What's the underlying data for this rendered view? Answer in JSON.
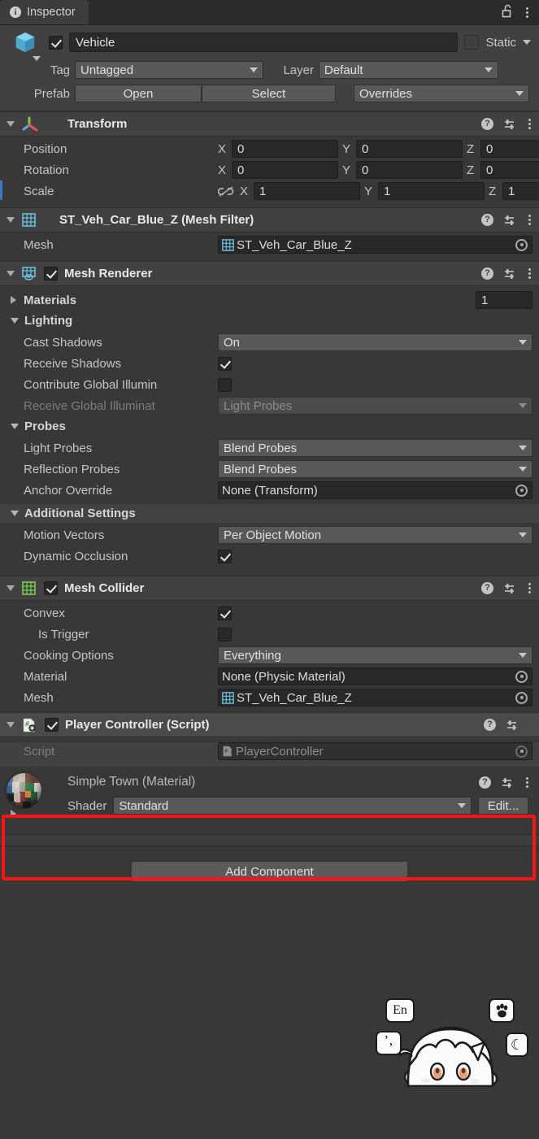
{
  "window": {
    "tab_label": "Inspector",
    "tab_icon": "info-icon",
    "lock_icon": "padlock-unlocked-icon",
    "menu_icon": "kebab-menu-icon"
  },
  "gameobject": {
    "icon": "cube-icon",
    "enabled": true,
    "name": "Vehicle",
    "static_label": "Static",
    "static_checked": false,
    "tag_label": "Tag",
    "tag_value": "Untagged",
    "layer_label": "Layer",
    "layer_value": "Default",
    "prefab_label": "Prefab",
    "prefab_open": "Open",
    "prefab_select": "Select",
    "prefab_overrides": "Overrides"
  },
  "components": [
    {
      "id": "transform",
      "title": "Transform",
      "icon": "transform-axis-icon",
      "rows": [
        {
          "label": "Position",
          "axes": [
            {
              "axis": "X",
              "value": "0"
            },
            {
              "axis": "Y",
              "value": "0"
            },
            {
              "axis": "Z",
              "value": "0"
            }
          ]
        },
        {
          "label": "Rotation",
          "axes": [
            {
              "axis": "X",
              "value": "0"
            },
            {
              "axis": "Y",
              "value": "0"
            },
            {
              "axis": "Z",
              "value": "0"
            }
          ]
        },
        {
          "label": "Scale",
          "link_icon": "broken-link-icon",
          "axes": [
            {
              "axis": "X",
              "value": "1"
            },
            {
              "axis": "Y",
              "value": "1"
            },
            {
              "axis": "Z",
              "value": "1"
            }
          ]
        }
      ]
    },
    {
      "id": "mesh-filter",
      "title": "ST_Veh_Car_Blue_Z (Mesh Filter)",
      "icon": "mesh-filter-grid-icon",
      "mesh_label": "Mesh",
      "mesh_value": "ST_Veh_Car_Blue_Z"
    },
    {
      "id": "mesh-renderer",
      "title": "Mesh Renderer",
      "icon": "mesh-renderer-icon",
      "enabled": true,
      "materials_label": "Materials",
      "materials_count": "1",
      "lighting_label": "Lighting",
      "cast_shadows_label": "Cast Shadows",
      "cast_shadows_value": "On",
      "receive_shadows_label": "Receive Shadows",
      "receive_shadows_checked": true,
      "contribute_gi_label": "Contribute Global Illumin",
      "contribute_gi_checked": false,
      "receive_gi_label": "Receive Global Illuminat",
      "receive_gi_value": "Light Probes",
      "probes_label": "Probes",
      "light_probes_label": "Light Probes",
      "light_probes_value": "Blend Probes",
      "reflection_probes_label": "Reflection Probes",
      "reflection_probes_value": "Blend Probes",
      "anchor_override_label": "Anchor Override",
      "anchor_override_value": "None (Transform)",
      "additional_settings_label": "Additional Settings",
      "motion_vectors_label": "Motion Vectors",
      "motion_vectors_value": "Per Object Motion",
      "dynamic_occlusion_label": "Dynamic Occlusion",
      "dynamic_occlusion_checked": true
    },
    {
      "id": "mesh-collider",
      "title": "Mesh Collider",
      "icon": "mesh-collider-grid-icon",
      "enabled": true,
      "convex_label": "Convex",
      "convex_checked": true,
      "is_trigger_label": "Is Trigger",
      "is_trigger_checked": false,
      "cooking_options_label": "Cooking Options",
      "cooking_options_value": "Everything",
      "material_label": "Material",
      "material_value": "None (Physic Material)",
      "mesh_label": "Mesh",
      "mesh_value": "ST_Veh_Car_Blue_Z"
    },
    {
      "id": "player-controller",
      "title": "Player Controller (Script)",
      "icon": "csharp-script-icon",
      "enabled": true,
      "script_label": "Script",
      "script_value": "PlayerController",
      "highlighted": true
    },
    {
      "id": "simple-town-material",
      "title": "Simple Town (Material)",
      "icon": "material-sphere-preview",
      "shader_label": "Shader",
      "shader_value": "Standard",
      "edit_label": "Edit..."
    }
  ],
  "footer": {
    "add_component_label": "Add Component"
  },
  "ime_widget": {
    "name": "sogou-ime-floating-widget",
    "keys": [
      {
        "name": "ime-mode-english",
        "label": "En"
      },
      {
        "name": "ime-paw-toolbox",
        "label": "✻"
      },
      {
        "name": "ime-punctuation",
        "label": "’‚"
      },
      {
        "name": "ime-night-mode",
        "label": "☾"
      }
    ]
  },
  "colors": {
    "window_bg": "#383838",
    "header_bg": "#414141",
    "field_bg": "#282828",
    "dropdown_bg": "#585858",
    "accent_blue": "#3a79bb",
    "highlight_red": "#fc1414",
    "icon_cyan": "#6ec6e8",
    "icon_green": "#7bd64a"
  }
}
